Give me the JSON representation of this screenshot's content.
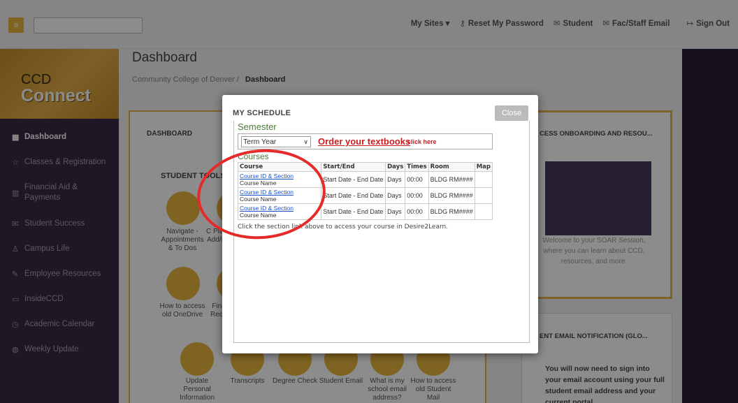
{
  "topbar": {
    "menu_icon": "hamburger-icon",
    "links": [
      {
        "label": "My Sites ▾",
        "icon": ""
      },
      {
        "label": "Reset My Password",
        "icon": "key-icon"
      },
      {
        "label": "Student",
        "icon": "mail-icon"
      },
      {
        "label": "Fac/Staff Email",
        "icon": "mail-outline-icon"
      },
      {
        "label": "Sign Out",
        "icon": "sign-out-icon"
      }
    ]
  },
  "sidebar": {
    "logo_line1": "CCD",
    "logo_line2": "Connect",
    "items": [
      {
        "label": "Dashboard",
        "icon": "grid-icon"
      },
      {
        "label": "Classes & Registration",
        "icon": "star-icon"
      },
      {
        "label": "Financial Aid & Payments",
        "icon": "chart-icon"
      },
      {
        "label": "Student Success",
        "icon": "envelope-icon"
      },
      {
        "label": "Campus Life",
        "icon": "person-icon"
      },
      {
        "label": "Employee Resources",
        "icon": "edit-icon"
      },
      {
        "label": "InsideCCD",
        "icon": "monitor-icon"
      },
      {
        "label": "Academic Calendar",
        "icon": "clock-icon"
      },
      {
        "label": "Weekly Update",
        "icon": "globe-icon"
      }
    ]
  },
  "main": {
    "title": "Dashboard",
    "breadcrumb_root": "Community College of Denver",
    "breadcrumb_sep": "/",
    "breadcrumb_current": "Dashboard",
    "dashboard_panel_title": "DASHBOARD",
    "student_tools_title": "STUDENT TOOLS",
    "tools": [
      "Navigate - Appointments & To Dos",
      "C Plan Add/D",
      "How to access old OneDrive",
      "Fina Requ",
      "Update Personal Information",
      "Transcripts",
      "Degree Check",
      "Student Email",
      "What is my school email address?",
      "How to access old Student Mail"
    ],
    "onboarding_title": "CESS ONBOARDING AND RESOU...",
    "onboarding_text": "Welcome to your SOAR Session, where you can learn about CCD, resources, and more.",
    "email_title": "ENT EMAIL NOTIFICATION (GLO...",
    "email_text": "You will now need to sign into your email account using your full student email address and your current portal"
  },
  "modal": {
    "title": "MY SCHEDULE",
    "close_label": "Close",
    "semester_label": "Semester",
    "term_value": "Term Year",
    "order_link": "Order your textbooks",
    "order_sub": "click here",
    "courses_label": "Courses",
    "columns": [
      "Course",
      "Start/End",
      "Days",
      "Times",
      "Room",
      "Map"
    ],
    "rows": [
      {
        "link": "Course ID & Section",
        "name": "Course Name",
        "dates": "Start Date - End Date",
        "days": "Days",
        "times": "00:00",
        "room": "BLDG RM####",
        "map": ""
      },
      {
        "link": "Course ID & Section",
        "name": "Course Name",
        "dates": "Start Date - End Date",
        "days": "Days",
        "times": "00:00",
        "room": "BLDG RM####",
        "map": ""
      },
      {
        "link": "Course ID & Section",
        "name": "Course Name",
        "dates": "Start Date - End Date",
        "days": "Days",
        "times": "00:00",
        "room": "BLDG RM####",
        "map": ""
      }
    ],
    "hint": "Click the section link above to access your course in Desire2Learn."
  },
  "colors": {
    "accent_gold": "#e8b43c",
    "sidebar_purple": "#3a2a44",
    "annotation_red": "#e52a2a",
    "link_red": "#c82020"
  }
}
